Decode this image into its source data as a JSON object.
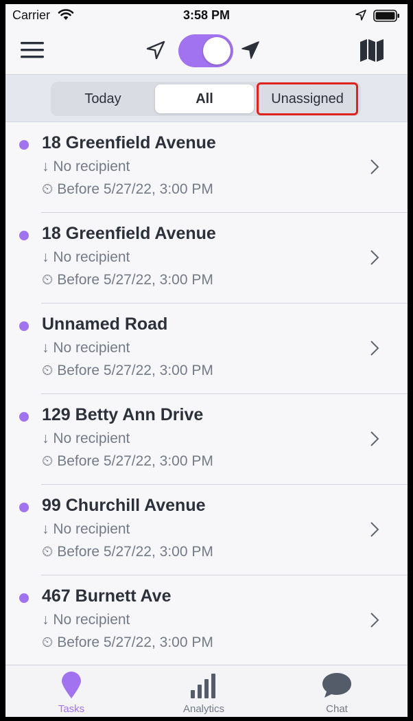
{
  "status_bar": {
    "carrier": "Carrier",
    "time": "3:58 PM"
  },
  "colors": {
    "accent": "#a173f0",
    "highlight_border": "#e0221f",
    "text_primary": "#2b303b",
    "text_secondary": "#737a88"
  },
  "header": {
    "icons": [
      "hamburger-menu-icon",
      "location-outline-icon",
      "location-filled-icon",
      "map-icon"
    ],
    "toggle_on": true
  },
  "segments": {
    "today": "Today",
    "all": "All",
    "unassigned": "Unassigned",
    "selected": "All"
  },
  "tasks": [
    {
      "address": "18 Greenfield Avenue",
      "recipient": "↓ No recipient",
      "deadline": "Before 5/27/22, 3:00 PM"
    },
    {
      "address": "18 Greenfield Avenue",
      "recipient": "↓ No recipient",
      "deadline": "Before 5/27/22, 3:00 PM"
    },
    {
      "address": "Unnamed Road",
      "recipient": "↓ No recipient",
      "deadline": "Before 5/27/22, 3:00 PM"
    },
    {
      "address": "129 Betty Ann Drive",
      "recipient": "↓ No recipient",
      "deadline": "Before 5/27/22, 3:00 PM"
    },
    {
      "address": "99 Churchill Avenue",
      "recipient": "↓ No recipient",
      "deadline": "Before 5/27/22, 3:00 PM"
    },
    {
      "address": "467 Burnett Ave",
      "recipient": "↓ No recipient",
      "deadline": "Before 5/27/22, 3:00 PM"
    }
  ],
  "tabbar": {
    "tasks": "Tasks",
    "analytics": "Analytics",
    "chat": "Chat",
    "active": "Tasks"
  }
}
